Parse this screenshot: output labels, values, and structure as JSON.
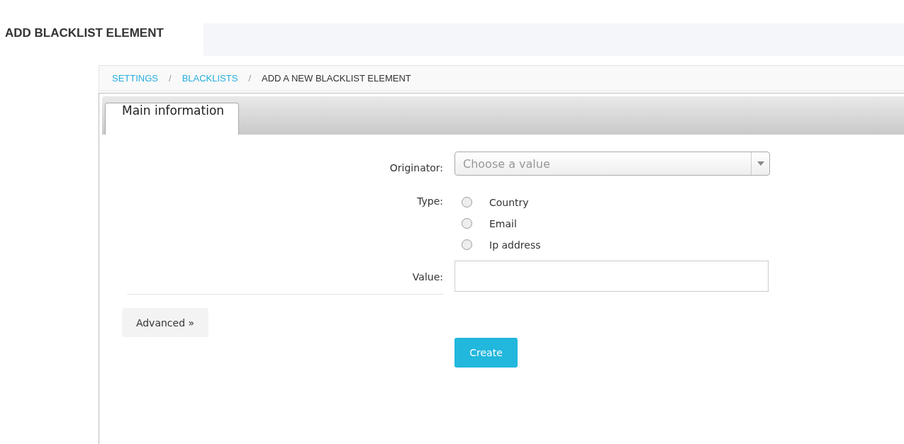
{
  "page_title": "ADD BLACKLIST ELEMENT",
  "breadcrumb": [
    {
      "label": "SETTINGS",
      "link": true
    },
    {
      "separator": "/",
      "label": "BLACKLISTS",
      "link": true
    },
    {
      "separator": "/",
      "label": "ADD A NEW BLACKLIST ELEMENT",
      "link": false
    }
  ],
  "tabs": [
    {
      "label": "Main information",
      "selected": true
    }
  ],
  "form": {
    "originator": {
      "label": "Originator:",
      "placeholder": "Choose a value"
    },
    "type": {
      "label": "Type:",
      "options": [
        {
          "label": "Country",
          "selected": false
        },
        {
          "label": "Email",
          "selected": false
        },
        {
          "label": "Ip address",
          "selected": false
        }
      ]
    },
    "value": {
      "label": "Value:"
    }
  },
  "buttons": {
    "advanced": "Advanced »",
    "create": "Create"
  }
}
